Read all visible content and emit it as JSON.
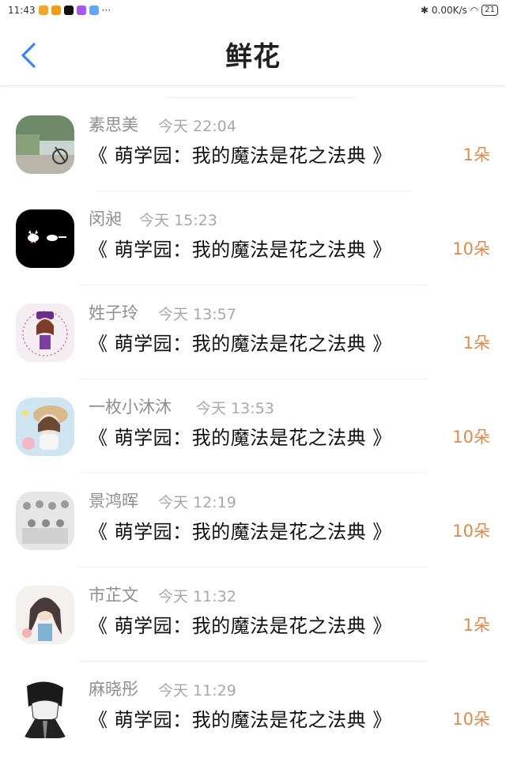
{
  "status_bar": {
    "time": "11:43",
    "dots": "···",
    "net_speed": "0.00K/s",
    "battery": "21"
  },
  "header": {
    "title": "鲜花"
  },
  "items": [
    {
      "name": "素思美",
      "time": "今天 22:04",
      "book": "《 萌学园：我的魔法是花之法典 》",
      "count": "1朵"
    },
    {
      "name": "闵昶",
      "time": "今天 15:23",
      "book": "《 萌学园：我的魔法是花之法典 》",
      "count": "10朵"
    },
    {
      "name": "姓子玲",
      "time": "今天 13:57",
      "book": "《 萌学园：我的魔法是花之法典 》",
      "count": "1朵"
    },
    {
      "name": "一枚小沐沐",
      "time": "今天 13:53",
      "book": "《 萌学园：我的魔法是花之法典 》",
      "count": "10朵"
    },
    {
      "name": "景鸿晖",
      "time": "今天 12:19",
      "book": "《 萌学园：我的魔法是花之法典 》",
      "count": "10朵"
    },
    {
      "name": "市芷文",
      "time": "今天 11:32",
      "book": "《 萌学园：我的魔法是花之法典 》",
      "count": "1朵"
    },
    {
      "name": "麻晓彤",
      "time": "今天 11:29",
      "book": "《 萌学园：我的魔法是花之法典 》",
      "count": "10朵"
    }
  ],
  "colors": {
    "accent_blue": "#3b82f6",
    "count_orange": "#e08a4b",
    "name_gray": "#8f8f8f"
  }
}
